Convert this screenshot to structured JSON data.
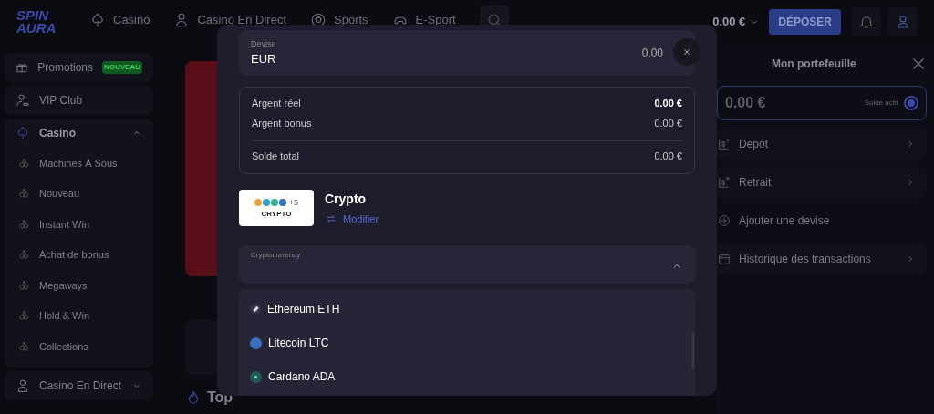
{
  "header": {
    "logo": "SPIN AURA",
    "nav": [
      {
        "label": "Casino",
        "kind": "casino"
      },
      {
        "label": "Casino En Direct",
        "kind": "live"
      },
      {
        "label": "Sports",
        "kind": "sports"
      },
      {
        "label": "E-Sport",
        "kind": "esport"
      }
    ],
    "balance": "0.00 €",
    "deposit_button": "DÉPOSER"
  },
  "sidebar": {
    "items": [
      {
        "label": "Promotions",
        "kind": "gift",
        "badge": "NOUVEAU"
      },
      {
        "label": "VIP Club",
        "kind": "vip"
      },
      {
        "label": "Casino",
        "kind": "casino",
        "expanded": true,
        "children": [
          {
            "label": "Machines À Sous"
          },
          {
            "label": "Nouveau"
          },
          {
            "label": "Instant Win"
          },
          {
            "label": "Achat de bonus"
          },
          {
            "label": "Megaways"
          },
          {
            "label": "Hold & Win"
          },
          {
            "label": "Collections"
          }
        ]
      },
      {
        "label": "Casino En Direct",
        "kind": "live",
        "expanded": false
      }
    ]
  },
  "main": {
    "section_title": "Top"
  },
  "wallet": {
    "title": "Mon portefeuille",
    "balance": {
      "amount": "0.00 €",
      "label": "Solde actif",
      "selected": true
    },
    "actions": [
      {
        "label": "Dépôt",
        "kind": "deposit"
      },
      {
        "label": "Retrait",
        "kind": "withdraw"
      },
      {
        "label": "Ajouter une devise",
        "kind": "add_currency"
      },
      {
        "label": "Historique des transactions",
        "kind": "history"
      }
    ]
  },
  "modal": {
    "currency_field": {
      "label": "Devise",
      "value": "EUR",
      "amount": "0.00"
    },
    "balances": [
      {
        "label": "Argent réel",
        "amount": "0.00 €",
        "kind": "real"
      },
      {
        "label": "Argent bonus",
        "amount": "0.00 €",
        "kind": "bonus"
      },
      {
        "label": "Solde total",
        "amount": "0.00 €",
        "kind": "total"
      }
    ],
    "payment_method": {
      "logo_extra": "+5",
      "logo_label": "CRYPTO",
      "name": "Crypto",
      "change_link": "Modifier"
    },
    "crypto_select": {
      "label": "Cryptocurrency",
      "expanded": true,
      "options": [
        {
          "label": "Ethereum ETH",
          "kind": "eth"
        },
        {
          "label": "Litecoin LTC",
          "kind": "ltc"
        },
        {
          "label": "Cardano ADA",
          "kind": "ada"
        }
      ]
    }
  }
}
